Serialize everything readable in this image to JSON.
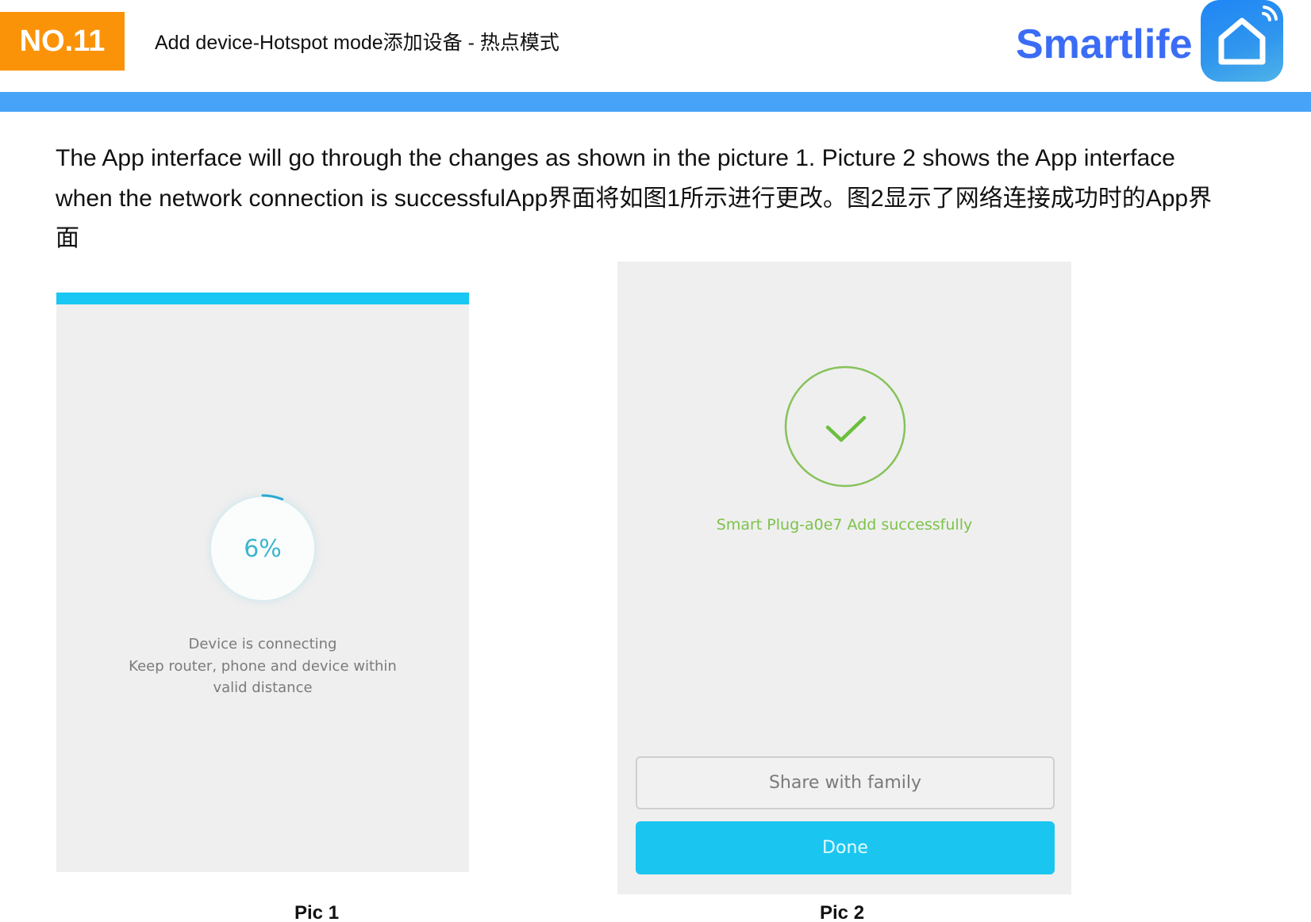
{
  "header": {
    "badge": "NO.11",
    "title": "Add device-Hotspot mode添加设备 - 热点模式",
    "brand": "Smartlife",
    "app_icon": "smartlife-home-wifi-icon",
    "colors": {
      "badge": "#fb9309",
      "brand_text": "#3b6cf6",
      "bar": "#47a3f8"
    }
  },
  "intro": {
    "text": "The App interface will go through the changes as shown in the picture 1. Picture 2 shows the App interface when the network connection is successfulApp界面将如图1所示进行更改。图2显示了网络连接成功时的App界面"
  },
  "pic1": {
    "progress_label": "6%",
    "progress_fraction": 0.06,
    "status_title": "Device is connecting",
    "status_hint_line1": "Keep router, phone and device within",
    "status_hint_line2": "valid distance",
    "caption": "Pic 1",
    "colors": {
      "accent": "#1ac6f3"
    }
  },
  "pic2": {
    "success_icon": "check-circle-icon",
    "success_message": "Smart Plug-a0e7 Add successfully",
    "share_button": "Share with family",
    "done_button": "Done",
    "caption": "Pic 2",
    "colors": {
      "success": "#7dc24a",
      "primary_button": "#1ac6f0"
    }
  }
}
